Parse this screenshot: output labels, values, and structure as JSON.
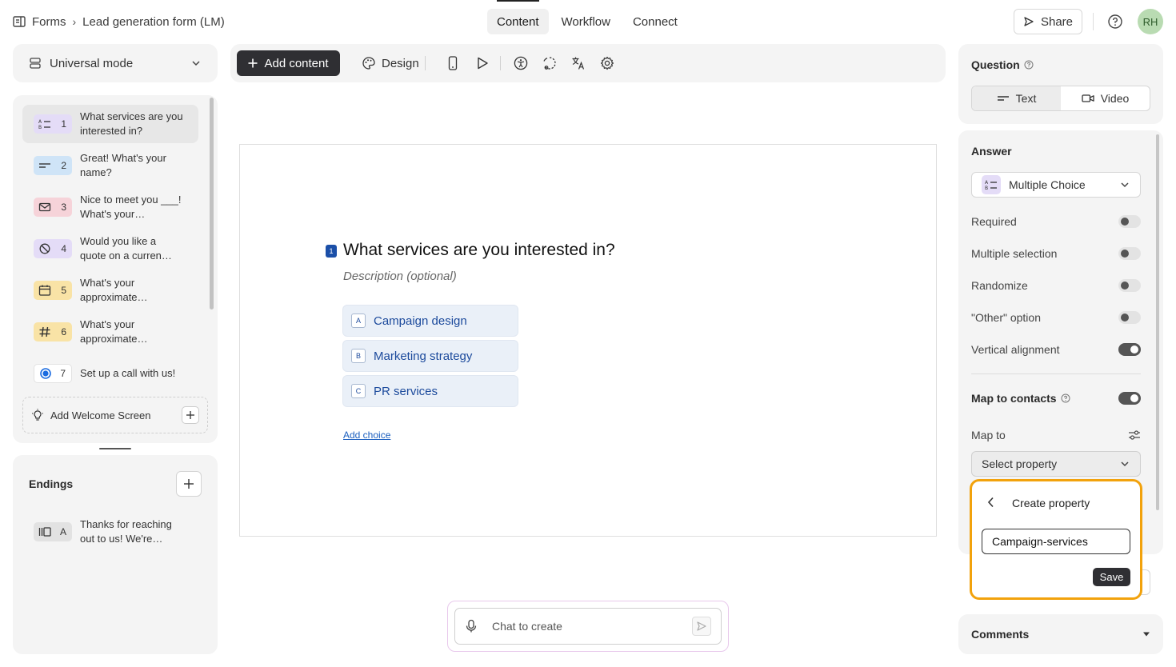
{
  "breadcrumb": {
    "root": "Forms",
    "separator": "›",
    "current": "Lead generation form (LM)"
  },
  "nav_tabs": [
    {
      "label": "Content",
      "active": true
    },
    {
      "label": "Workflow",
      "active": false
    },
    {
      "label": "Connect",
      "active": false
    }
  ],
  "header": {
    "share_label": "Share",
    "avatar_initials": "RH"
  },
  "mode": {
    "label": "Universal mode"
  },
  "questions": [
    {
      "num": "1",
      "text": "What services are you interested in?",
      "icon": "multiple-choice-icon",
      "color": "#e4dcf7",
      "active": true
    },
    {
      "num": "2",
      "text": "Great! What's your name?",
      "icon": "short-text-icon",
      "color": "#cfe4f7",
      "active": false
    },
    {
      "num": "3",
      "text": "Nice to meet you ___! What's your…",
      "icon": "email-icon",
      "color": "#f6d3d9",
      "active": false
    },
    {
      "num": "4",
      "text": "Would you like a quote on a curren…",
      "icon": "no-icon",
      "color": "#e4dcf7",
      "active": false
    },
    {
      "num": "5",
      "text": "What's your approximate…",
      "icon": "calendar-icon",
      "color": "#f9e3a6",
      "active": false
    },
    {
      "num": "6",
      "text": "What's your approximate…",
      "icon": "number-icon",
      "color": "#f9e3a6",
      "active": false
    },
    {
      "num": "7",
      "text": "Set up a call with us!",
      "icon": "calendly-icon",
      "color": "#ffffff",
      "active": false
    }
  ],
  "welcome": {
    "label": "Add Welcome Screen"
  },
  "endings": {
    "title": "Endings",
    "items": [
      {
        "key": "A",
        "text": "Thanks for reaching out to us! We're…"
      }
    ]
  },
  "toolbar": {
    "add_content_label": "Add content",
    "design_label": "Design"
  },
  "canvas": {
    "question_num": "1",
    "question_title": "What services are you interested in?",
    "description_placeholder": "Description (optional)",
    "choices": [
      {
        "key": "A",
        "label": "Campaign design"
      },
      {
        "key": "B",
        "label": "Marketing strategy"
      },
      {
        "key": "C",
        "label": "PR services"
      }
    ],
    "add_choice_label": "Add choice"
  },
  "chat": {
    "placeholder": "Chat to create"
  },
  "right": {
    "question_title": "Question",
    "question_types": [
      {
        "label": "Text",
        "active": true
      },
      {
        "label": "Video",
        "active": false
      }
    ],
    "answer_title": "Answer",
    "answer_type": "Multiple Choice",
    "options": [
      {
        "label": "Required",
        "on": false
      },
      {
        "label": "Multiple selection",
        "on": false
      },
      {
        "label": "Randomize",
        "on": false
      },
      {
        "label": "\"Other\" option",
        "on": false
      },
      {
        "label": "Vertical alignment",
        "on": true
      }
    ],
    "map_to_contacts_label": "Map to contacts",
    "map_to_contacts_on": true,
    "map_to_label": "Map to",
    "select_property_label": "Select property",
    "comments_label": "Comments"
  },
  "popup": {
    "title": "Create property",
    "input_value": "Campaign-services",
    "save_label": "Save"
  },
  "colors": {
    "accent": "#2f2f33",
    "highlight": "#f2a20c",
    "choice_text": "#1c4a9c",
    "avatar_bg": "#b9dbb2"
  }
}
